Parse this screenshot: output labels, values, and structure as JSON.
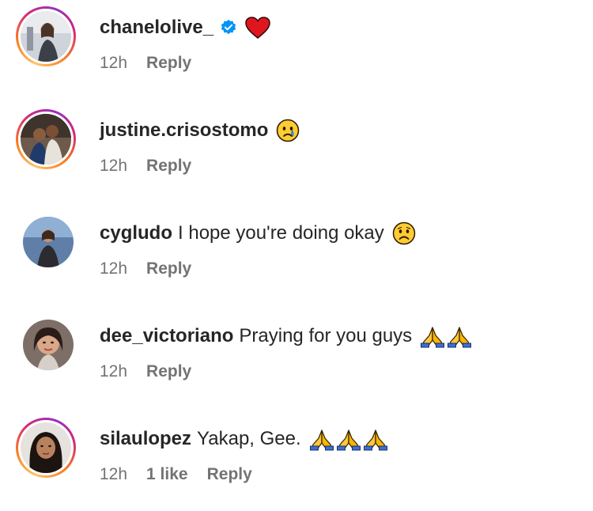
{
  "comments": [
    {
      "username": "chanelolive_",
      "text": "",
      "verified": true,
      "emojis": [
        "red-heart"
      ],
      "time": "12h",
      "likes": "",
      "reply_label": "Reply",
      "story_ring": true
    },
    {
      "username": "justine.crisostomo",
      "text": "",
      "verified": false,
      "emojis": [
        "crying-face"
      ],
      "time": "12h",
      "likes": "",
      "reply_label": "Reply",
      "story_ring": true
    },
    {
      "username": "cygludo",
      "text": "I hope you're doing okay",
      "verified": false,
      "emojis": [
        "sad-face"
      ],
      "time": "12h",
      "likes": "",
      "reply_label": "Reply",
      "story_ring": false
    },
    {
      "username": "dee_victoriano",
      "text": "Praying for you guys",
      "verified": false,
      "emojis": [
        "folded-hands",
        "folded-hands"
      ],
      "time": "12h",
      "likes": "",
      "reply_label": "Reply",
      "story_ring": false
    },
    {
      "username": "silaulopez",
      "text": "Yakap, Gee.",
      "verified": false,
      "emojis": [
        "folded-hands",
        "folded-hands",
        "folded-hands"
      ],
      "time": "12h",
      "likes": "1 like",
      "reply_label": "Reply",
      "story_ring": true
    }
  ],
  "colors": {
    "text": "#262626",
    "meta": "#737373",
    "verified": "#0095f6"
  }
}
